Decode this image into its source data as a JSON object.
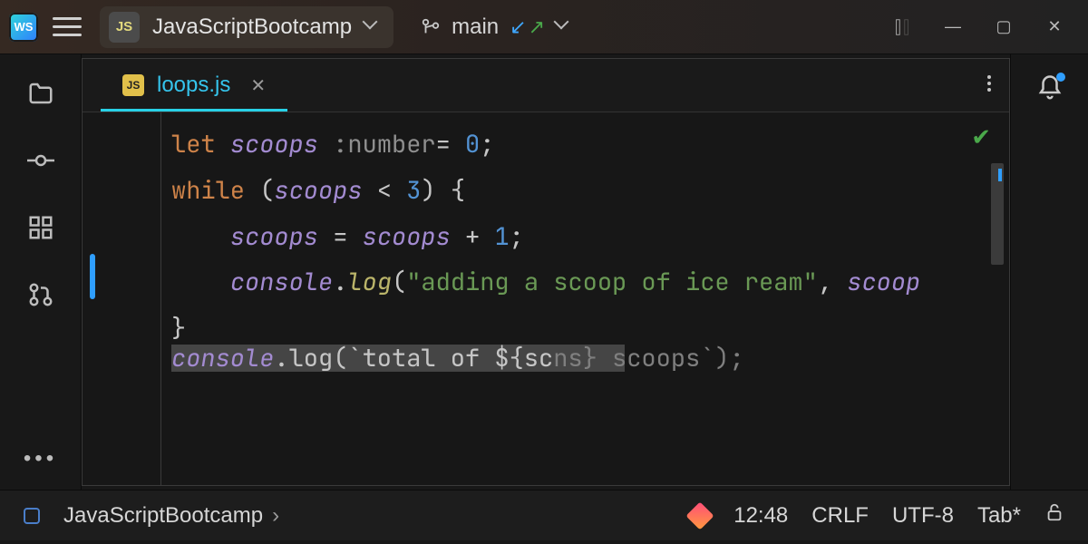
{
  "titlebar": {
    "app_logo_text": "WS",
    "project_badge": "JS",
    "project_name": "JavaScriptBootcamp",
    "branch_name": "main"
  },
  "tabs": [
    {
      "badge": "JS",
      "name": "loops.js",
      "active": true
    }
  ],
  "code": {
    "line1_let": "let",
    "line1_var": "scoops",
    "line1_typehint": " :number",
    "line1_eq": "= ",
    "line1_num": "0",
    "line1_semi": ";",
    "line2_while": "while",
    "line2_open": " (",
    "line2_var": "scoops",
    "line2_lt": " < ",
    "line2_num": "3",
    "line2_close": ") {",
    "line3_indent": "    ",
    "line3_var": "scoops",
    "line3_eq": " = ",
    "line3_var2": "scoops",
    "line3_plus": " + ",
    "line3_num": "1",
    "line3_semi": ";",
    "line4_indent": "    ",
    "line4_obj": "console",
    "line4_dot": ".",
    "line4_method": "log",
    "line4_open": "(",
    "line4_str": "\"adding a scoop of ice ream\"",
    "line4_comma": ", ",
    "line4_var": "scoop",
    "line5_brace": "}",
    "partial_a": "console",
    "partial_b": ".log(`total of ${sc",
    "partial_c": "ns} scoops`);"
  },
  "statusbar": {
    "breadcrumb_project": "JavaScriptBootcamp",
    "breadcrumb_sep": "›",
    "cursor_pos": "12:48",
    "line_sep": "CRLF",
    "encoding": "UTF-8",
    "indent": "Tab*"
  }
}
